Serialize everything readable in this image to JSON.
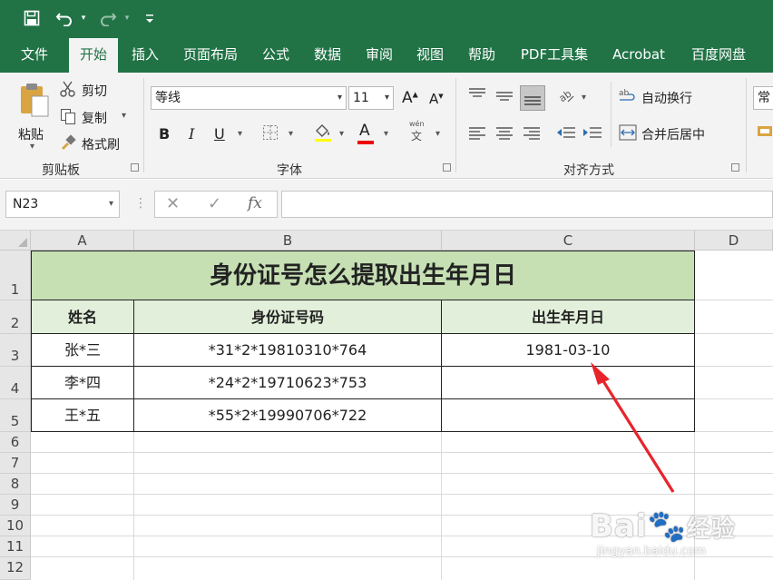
{
  "qat": {
    "save_icon": "save-icon",
    "undo_icon": "undo-icon",
    "redo_icon": "redo-icon",
    "customize_icon": "customize-qat-icon"
  },
  "tabs": [
    {
      "label": "文件"
    },
    {
      "label": "开始"
    },
    {
      "label": "插入"
    },
    {
      "label": "页面布局"
    },
    {
      "label": "公式"
    },
    {
      "label": "数据"
    },
    {
      "label": "审阅"
    },
    {
      "label": "视图"
    },
    {
      "label": "帮助"
    },
    {
      "label": "PDF工具集"
    },
    {
      "label": "Acrobat"
    },
    {
      "label": "百度网盘"
    }
  ],
  "ribbon": {
    "clipboard": {
      "paste": "粘贴",
      "cut": "剪切",
      "copy": "复制",
      "format_painter": "格式刷",
      "group_label": "剪贴板"
    },
    "font": {
      "font_name": "等线",
      "font_size": "11",
      "bold": "B",
      "italic": "I",
      "underline": "U",
      "font_color_letter": "A",
      "phonetic_top": "wén",
      "phonetic_bottom": "文",
      "group_label": "字体"
    },
    "alignment": {
      "wrap_text": "自动换行",
      "merge_center": "合并后居中",
      "group_label": "对齐方式"
    },
    "number": {
      "format_partial": "常规"
    }
  },
  "formula_bar": {
    "name_box": "N23",
    "cancel": "✕",
    "enter": "✓",
    "fx": "fx",
    "formula": ""
  },
  "columns": [
    {
      "label": "A"
    },
    {
      "label": "B"
    },
    {
      "label": "C"
    },
    {
      "label": "D"
    }
  ],
  "rows": [
    "1",
    "2",
    "3",
    "4",
    "5",
    "6",
    "7",
    "8",
    "9",
    "10",
    "11",
    "12"
  ],
  "sheet": {
    "title": "身份证号怎么提取出生年月日",
    "headers": {
      "name": "姓名",
      "id": "身份证号码",
      "birth": "出生年月日"
    },
    "records": [
      {
        "name": "张*三",
        "id": "*31*2*19810310*764",
        "birth": "1981-03-10"
      },
      {
        "name": "李*四",
        "id": "*24*2*19710623*753",
        "birth": ""
      },
      {
        "name": "王*五",
        "id": "*55*2*19990706*722",
        "birth": ""
      }
    ]
  },
  "annotation": {
    "color": "#e8242b"
  },
  "watermark": {
    "brand": "Bai",
    "brand_cn": "经验",
    "url": "jingyan.baidu.com"
  },
  "colors": {
    "accent": "#217346",
    "title_fill": "#c6e0b4",
    "header_fill": "#e2efda"
  }
}
